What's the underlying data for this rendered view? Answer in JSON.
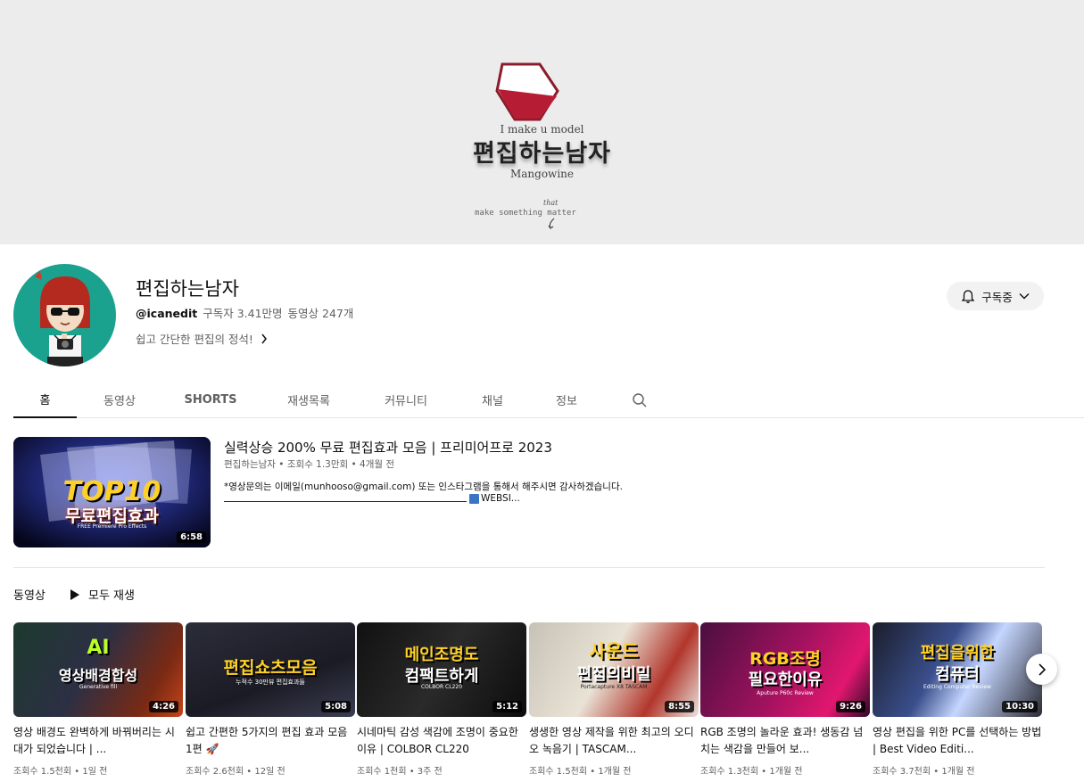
{
  "banner": {
    "tagline": "I make u model",
    "title": "편집하는남자",
    "subtitle": "Mangowine",
    "motto_small": "that",
    "motto": "make something matter"
  },
  "channel": {
    "name": "편집하는남자",
    "handle": "@icanedit",
    "subscribers": "구독자 3.41만명",
    "videos_count": "동영상 247개",
    "description": "쉽고 간단한 편집의 정석!",
    "subscribe_label": "구독중"
  },
  "tabs": [
    {
      "label": "홈"
    },
    {
      "label": "동영상"
    },
    {
      "label": "SHORTS"
    },
    {
      "label": "재생목록"
    },
    {
      "label": "커뮤니티"
    },
    {
      "label": "채널"
    },
    {
      "label": "정보"
    }
  ],
  "featured": {
    "title": "실력상승 200% 무료 편집효과 모음 | 프리미어프로 2023",
    "meta": "편집하는남자 • 조회수 1.3만회 • 4개월 전",
    "desc_line1": "*영상문의는 이메일(munhooso@gmail.com) 또는 인스타그램을 통해서 해주시면 감사하겠습니다.",
    "desc_line2": "WEBSI...",
    "duration": "6:58",
    "thumb_line1": "TOP10",
    "thumb_line2": "무료편집효과",
    "thumb_caption": "FREE Premiere Pro Effects"
  },
  "section": {
    "title": "동영상",
    "play_all": "모두 재생"
  },
  "videos": [
    {
      "title": "영상 배경도 완벽하게 바꿔버리는 시대가 되었습니다 | ...",
      "meta": "조회수 1.5천회 • 1일 전",
      "duration": "4:26",
      "thumb_line1": "AI",
      "thumb_line2": "영상배경합성",
      "thumb_caption": "Generative fill"
    },
    {
      "title": "쉽고 간편한 5가지의 편집 효과 모음 1편 🚀",
      "meta": "조회수 2.6천회 • 12일 전",
      "duration": "5:08",
      "thumb_line1": "편집쇼츠모음",
      "thumb_line2": "",
      "thumb_caption": "누적수 30만뷰 편집효과들"
    },
    {
      "title": "시네마틱 감성 색감에 조명이 중요한 이유 | COLBOR CL220",
      "meta": "조회수 1천회 • 3주 전",
      "duration": "5:12",
      "thumb_line1": "메인조명도",
      "thumb_line2": "컴팩트하게",
      "thumb_caption": "COLBOR CL220"
    },
    {
      "title": "생생한 영상 제작을 위한 최고의 오디오 녹음기 | TASCAM...",
      "meta": "조회수 1.5천회 • 1개월 전",
      "duration": "8:55",
      "thumb_line1": "사운드",
      "thumb_line2": "편집의비밀",
      "thumb_caption": "Portacapture X8 TASCAM"
    },
    {
      "title": "RGB 조명의 놀라운 효과! 생동감 넘치는 색감을 만들어 보...",
      "meta": "조회수 1.3천회 • 1개월 전",
      "duration": "9:26",
      "thumb_line1": "RGB조명",
      "thumb_line2": "필요한이유",
      "thumb_caption": "Aputure P60c Review"
    },
    {
      "title": "영상 편집을 위한 PC를 선택하는 방법 | Best Video Editi...",
      "meta": "조회수 3.7천회 • 1개월 전",
      "duration": "10:30",
      "thumb_line1": "편집을위한",
      "thumb_line2": "컴퓨터",
      "thumb_caption": "Editing Computer Review"
    }
  ]
}
